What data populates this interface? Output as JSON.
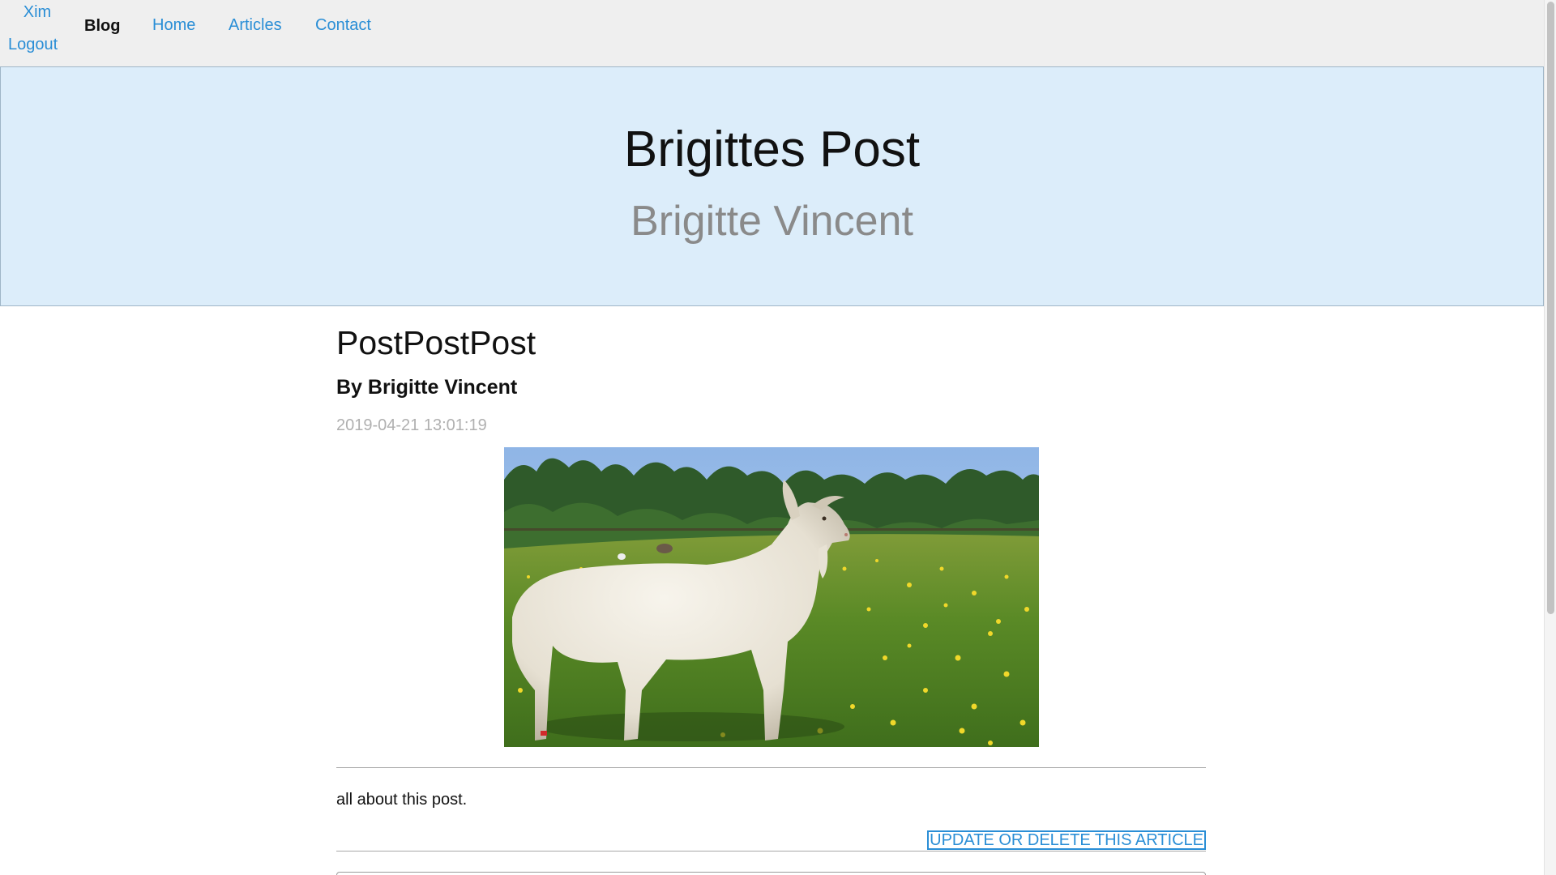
{
  "nav": {
    "user": "Xim",
    "logout": "Logout",
    "brand": "Blog",
    "links": [
      "Home",
      "Articles",
      "Contact"
    ]
  },
  "hero": {
    "title": "Brigittes Post",
    "subtitle": "Brigitte Vincent"
  },
  "article": {
    "title": "PostPostPost",
    "byline": "By Brigitte Vincent",
    "date": "2019-04-21 13:01:19",
    "image_icon": "goat-photo",
    "body": "all about this post.",
    "update_link": "UPDATE OR DELETE THIS ARTICLE"
  },
  "colors": {
    "link": "#2a8ed6",
    "hero_bg": "#dcedfa",
    "nav_bg": "#efefef"
  }
}
